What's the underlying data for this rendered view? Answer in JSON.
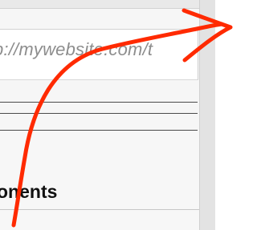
{
  "address_bar": {
    "url_text": "p://mywebsite.com/t"
  },
  "section": {
    "title": "onents"
  },
  "annotation": {
    "stroke_color": "#ff2a00"
  }
}
